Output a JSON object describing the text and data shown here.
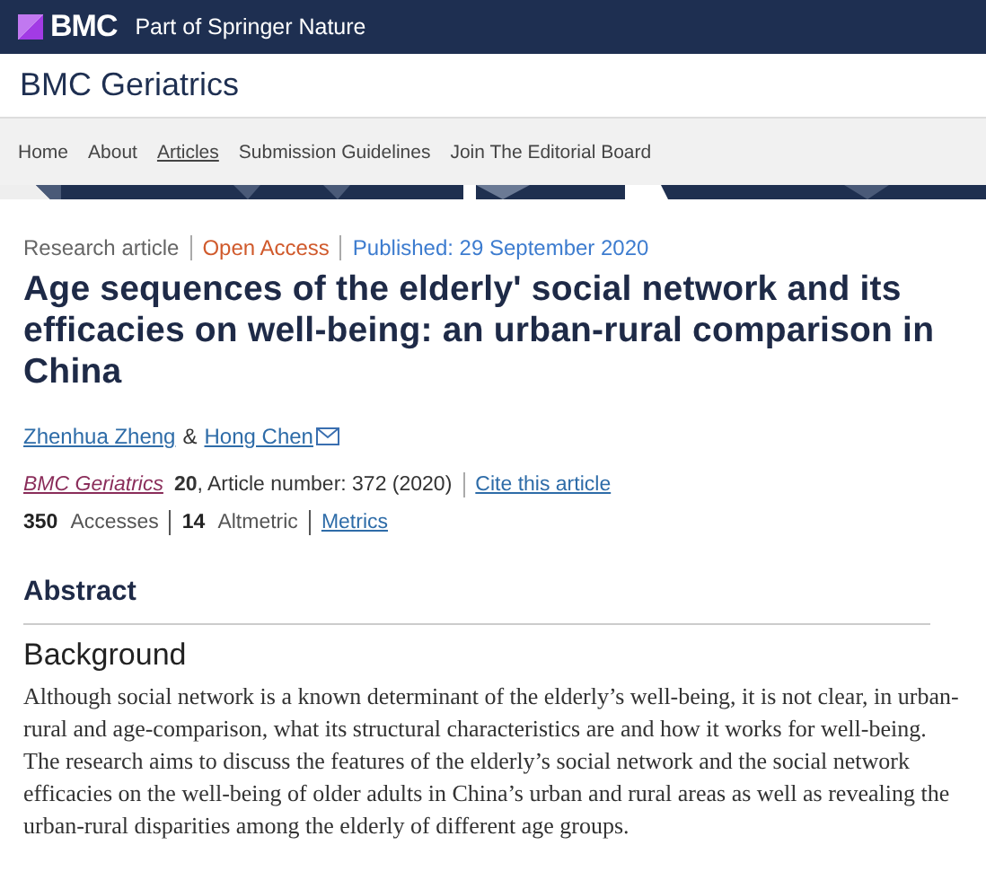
{
  "brand": {
    "logo": "BMC",
    "tagline": "Part of Springer Nature"
  },
  "journal_title": "BMC Geriatrics",
  "nav": [
    {
      "label": "Home",
      "selected": false
    },
    {
      "label": "About",
      "selected": false
    },
    {
      "label": "Articles",
      "selected": true
    },
    {
      "label": "Submission Guidelines",
      "selected": false
    },
    {
      "label": "Join The Editorial Board",
      "selected": false
    }
  ],
  "article": {
    "type": "Research article",
    "access": "Open Access",
    "published": "Published: 29 September 2020",
    "title": "Age sequences of the elderly' social network and its efficacies on well-being: an urban-rural comparison in China",
    "authors": [
      {
        "name": "Zhenhua Zheng",
        "contact": false
      },
      {
        "name": "Hong Chen",
        "contact": true
      }
    ],
    "author_separator": "&",
    "journal": "BMC Geriatrics",
    "volume": "20",
    "article_number": ", Article number: 372 (2020)",
    "cite": "Cite this article",
    "metrics": [
      {
        "count": "350",
        "label": "Accesses"
      },
      {
        "count": "14",
        "label": "Altmetric"
      }
    ],
    "metrics_link": "Metrics"
  },
  "abstract": {
    "heading": "Abstract",
    "section": "Background",
    "text": "Although social network is a known determinant of the elderly’s well-being, it is not clear, in urban-rural and age-comparison, what its structural characteristics are and how it works for well-being. The research aims to discuss the features of the elderly’s social network and the social network efficacies on the well-being of older adults in China’s urban and rural areas as well as revealing the urban-rural disparities among the elderly of different age groups."
  }
}
